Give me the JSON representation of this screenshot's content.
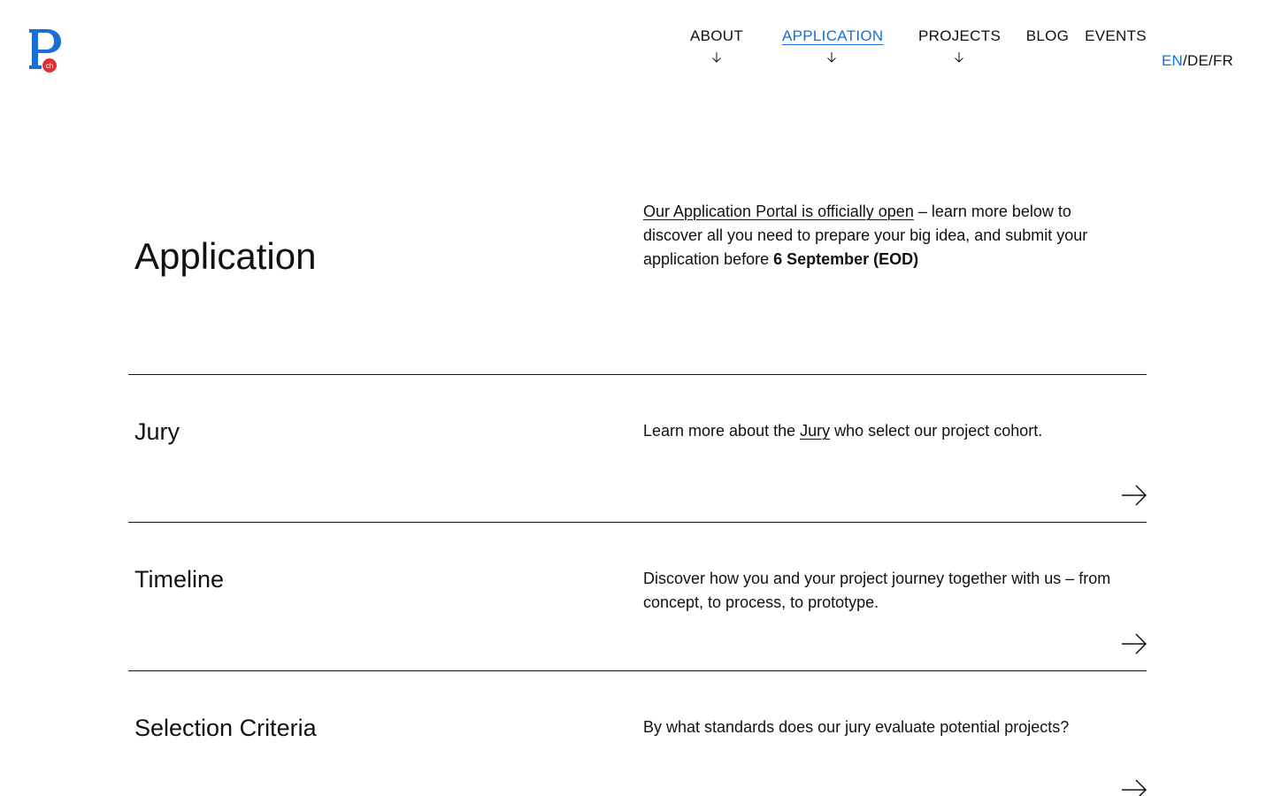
{
  "logo": {
    "letter": "P",
    "badge": "ch",
    "primary_color": "#1a6fd6",
    "badge_color": "#e53030"
  },
  "nav": {
    "items": [
      {
        "label": "ABOUT",
        "has_dropdown": true
      },
      {
        "label": "APPLICATION",
        "has_dropdown": true,
        "active": true
      },
      {
        "label": "PROJECTS",
        "has_dropdown": true
      },
      {
        "label": "BLOG",
        "has_dropdown": false
      },
      {
        "label": "EVENTS",
        "has_dropdown": false
      }
    ],
    "languages": {
      "en": "EN",
      "de": "DE",
      "fr": "FR",
      "separator": "/",
      "active": "EN"
    },
    "dropdown_icon": "arrow-down-icon",
    "active_color": "#1a6fd6"
  },
  "hero": {
    "title": "Application",
    "link_text": "Our Application Portal is officially open",
    "text_middle": " – learn more below to discover all you need to prepare your big idea, and submit your application before ",
    "deadline": "6 September (EOD)"
  },
  "sections": [
    {
      "title": "Jury",
      "text_before": "Learn more about the ",
      "link_text": "Jury",
      "text_after": " who select our project cohort.",
      "icon": "arrow-right-icon"
    },
    {
      "title": "Timeline",
      "text": "Discover how you and your project journey together with us – from concept, to process, to prototype.",
      "icon": "arrow-right-icon"
    },
    {
      "title": "Selection Criteria",
      "text": "By what standards does our jury evaluate potential projects?",
      "icon": "arrow-right-icon"
    }
  ]
}
